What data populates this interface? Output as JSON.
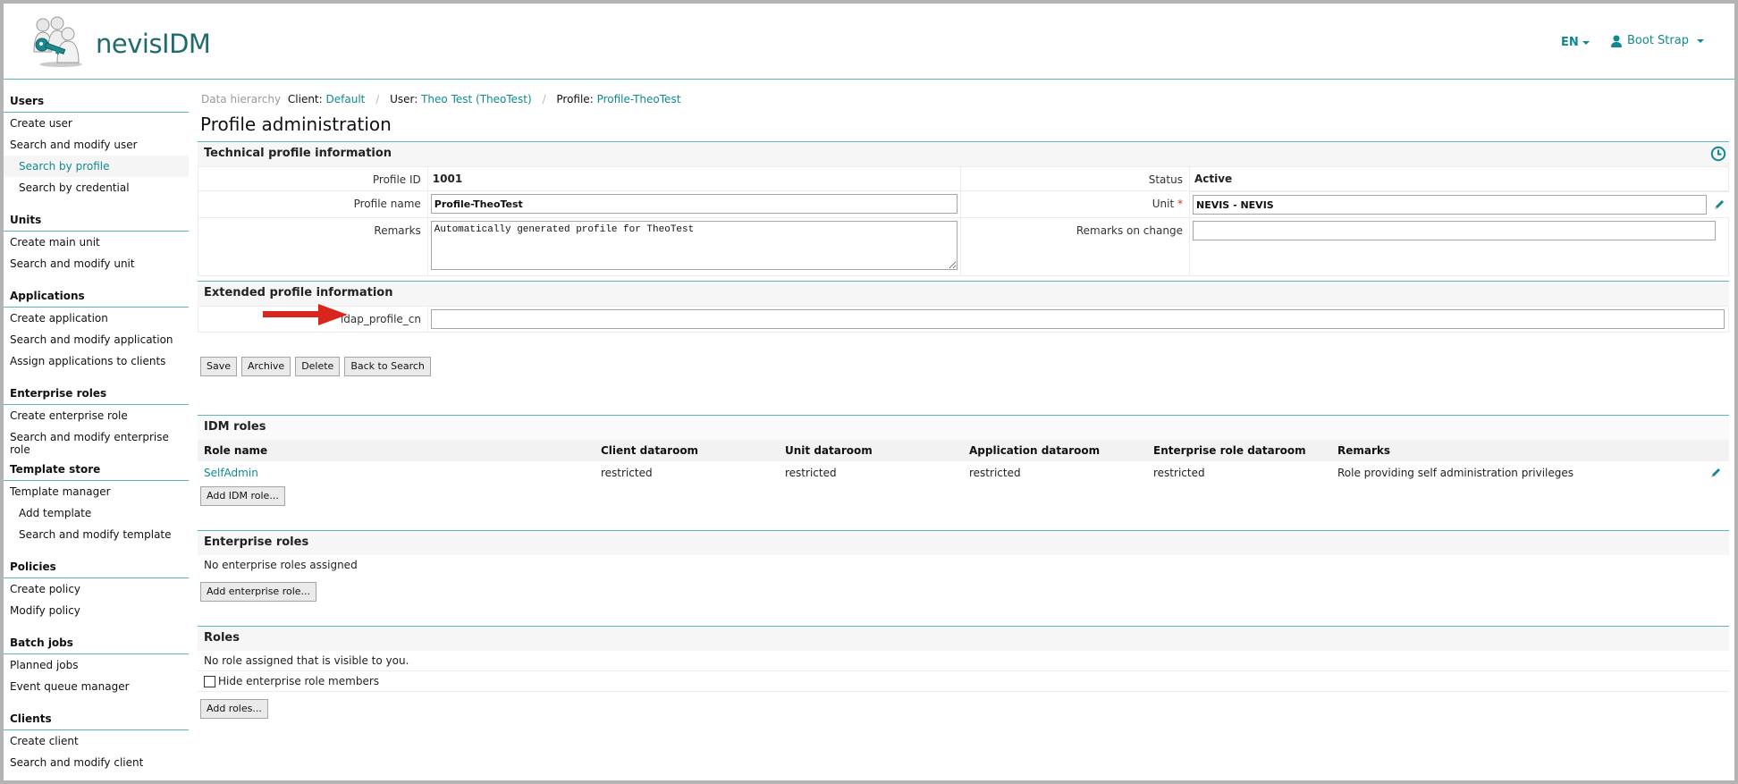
{
  "app": {
    "brand": "nevisIDM",
    "language": "EN",
    "user_name": "Boot Strap",
    "accent_color": "#0e8a8f"
  },
  "sidebar": {
    "groups": [
      {
        "title": "Users",
        "items": [
          {
            "label": "Create user",
            "sub": false
          },
          {
            "label": "Search and modify user",
            "sub": false
          },
          {
            "label": "Search by profile",
            "sub": true,
            "active": true
          },
          {
            "label": "Search by credential",
            "sub": true
          }
        ]
      },
      {
        "title": "Units",
        "items": [
          {
            "label": "Create main unit"
          },
          {
            "label": "Search and modify unit"
          }
        ]
      },
      {
        "title": "Applications",
        "items": [
          {
            "label": "Create application"
          },
          {
            "label": "Search and modify application"
          },
          {
            "label": "Assign applications to clients"
          }
        ]
      },
      {
        "title": "Enterprise roles",
        "items": [
          {
            "label": "Create enterprise role"
          },
          {
            "label": "Search and modify enterprise role"
          }
        ]
      },
      {
        "title": "Template store",
        "items": [
          {
            "label": "Template manager"
          },
          {
            "label": "Add template",
            "sub": true
          },
          {
            "label": "Search and modify template",
            "sub": true
          }
        ]
      },
      {
        "title": "Policies",
        "items": [
          {
            "label": "Create policy"
          },
          {
            "label": "Modify policy"
          }
        ]
      },
      {
        "title": "Batch jobs",
        "items": [
          {
            "label": "Planned jobs"
          },
          {
            "label": "Event queue manager"
          }
        ]
      },
      {
        "title": "Clients",
        "items": [
          {
            "label": "Create client"
          },
          {
            "label": "Search and modify client"
          }
        ]
      }
    ]
  },
  "breadcrumb": {
    "lead": "Data hierarchy",
    "client_label": "Client:",
    "client_value": "Default",
    "user_label": "User:",
    "user_value": "Theo Test (TheoTest)",
    "profile_label": "Profile:",
    "profile_value": "Profile-TheoTest"
  },
  "page_title": "Profile administration",
  "technical": {
    "title": "Technical profile information",
    "profile_id_label": "Profile ID",
    "profile_id": "1001",
    "status_label": "Status",
    "status": "Active",
    "profile_name_label": "Profile name",
    "profile_name": "Profile-TheoTest",
    "unit_label": "Unit",
    "unit_required": "*",
    "unit": "NEVIS - NEVIS",
    "remarks_label": "Remarks",
    "remarks": "Automatically generated profile for TheoTest",
    "remarks_on_change_label": "Remarks on change",
    "remarks_on_change": ""
  },
  "extended": {
    "title": "Extended profile information",
    "ldap_label": "ldap_profile_cn",
    "ldap_value": ""
  },
  "actions": {
    "save": "Save",
    "archive": "Archive",
    "delete": "Delete",
    "back": "Back to Search"
  },
  "idm_roles": {
    "title": "IDM roles",
    "columns": [
      "Role name",
      "Client dataroom",
      "Unit dataroom",
      "Application dataroom",
      "Enterprise role dataroom",
      "Remarks"
    ],
    "rows": [
      {
        "role_name": "SelfAdmin",
        "client": "restricted",
        "unit": "restricted",
        "application": "restricted",
        "enterprise": "restricted",
        "remarks": "Role providing self administration privileges"
      }
    ],
    "add_button": "Add IDM role..."
  },
  "enterprise_roles": {
    "title": "Enterprise roles",
    "empty": "No enterprise roles assigned",
    "add_button": "Add enterprise role..."
  },
  "roles": {
    "title": "Roles",
    "empty": "No role assigned that is visible to you.",
    "hide_members_label": "Hide enterprise role members",
    "hide_members_checked": false,
    "add_button": "Add roles..."
  }
}
